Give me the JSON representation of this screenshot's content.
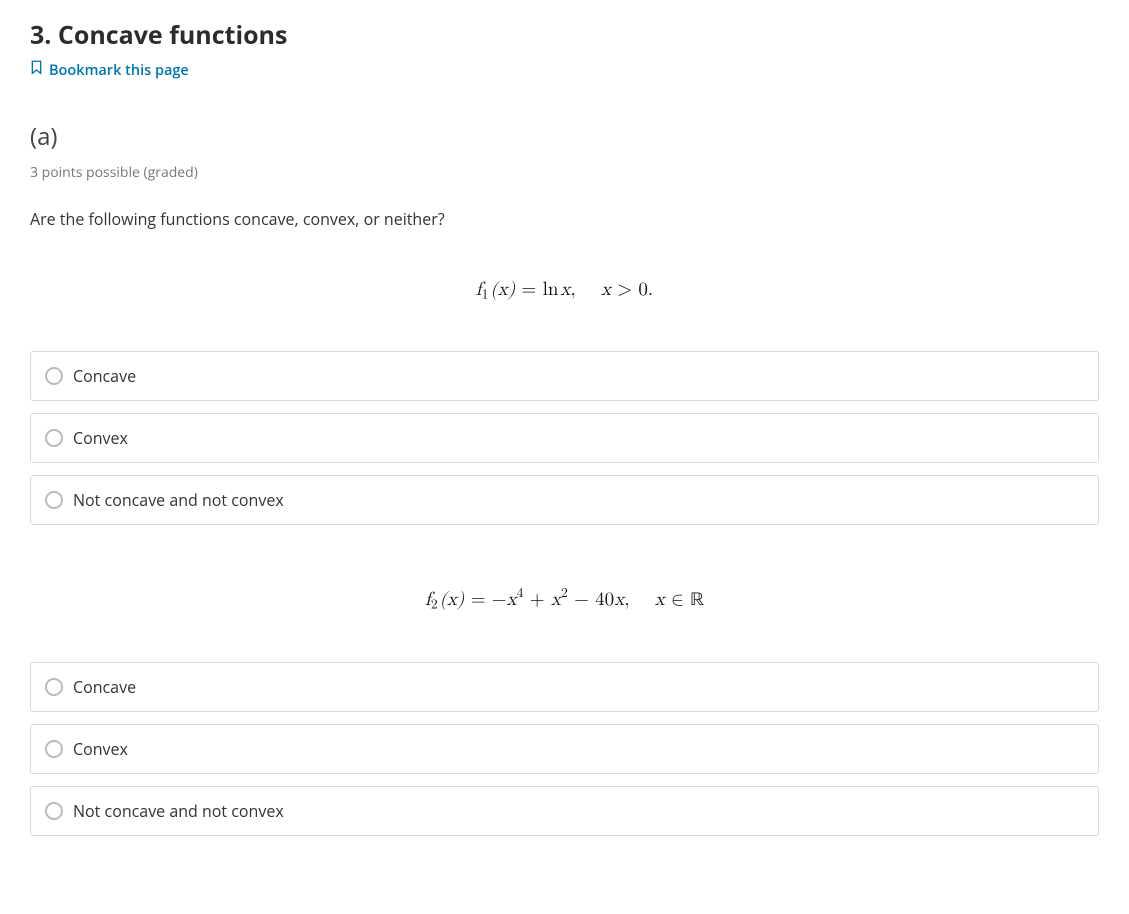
{
  "page_title": "3. Concave functions",
  "bookmark_label": "Bookmark this page",
  "part_label": "(a)",
  "points_text": "3 points possible (graded)",
  "prompt": "Are the following functions concave, convex, or neither?",
  "question1": {
    "options": {
      "opt1": "Concave",
      "opt2": "Convex",
      "opt3": "Not concave and not convex"
    }
  },
  "question2": {
    "options": {
      "opt1": "Concave",
      "opt2": "Convex",
      "opt3": "Not concave and not convex"
    }
  }
}
